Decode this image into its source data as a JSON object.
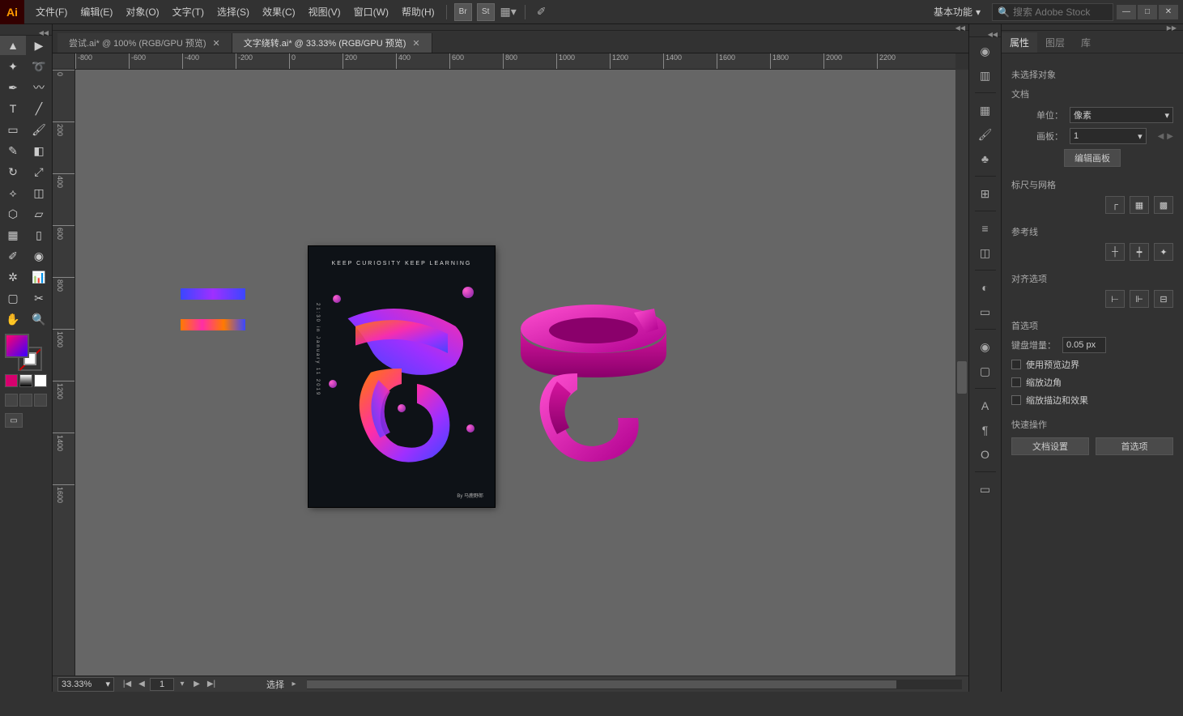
{
  "menu": [
    "文件(F)",
    "编辑(E)",
    "对象(O)",
    "文字(T)",
    "选择(S)",
    "效果(C)",
    "视图(V)",
    "窗口(W)",
    "帮助(H)"
  ],
  "menu_icons": [
    "Br",
    "St"
  ],
  "workspace": "基本功能",
  "search_placeholder": "搜索 Adobe Stock",
  "tabs": [
    {
      "label": "尝试.ai* @ 100% (RGB/GPU 预览)",
      "active": false
    },
    {
      "label": "文字绕转.ai* @ 33.33% (RGB/GPU 预览)",
      "active": true
    }
  ],
  "ruler_h": [
    -800,
    -600,
    -400,
    -200,
    0,
    200,
    400,
    600,
    800,
    1000,
    1200,
    1400,
    1600,
    1800,
    2000,
    2200
  ],
  "ruler_v": [
    0,
    200,
    400,
    600,
    800,
    1000,
    1200,
    1400,
    1600
  ],
  "artboard": {
    "title": "KEEP CURIOSITY KEEP LEARNING",
    "side": "21:30 in January 11 2019",
    "foot": "By 马鹿野郎"
  },
  "statusbar": {
    "zoom": "33.33%",
    "artboard": "1",
    "tool": "选择"
  },
  "panel": {
    "tabs": [
      "属性",
      "图层",
      "库"
    ],
    "no_selection": "未选择对象",
    "doc": "文档",
    "units_label": "单位：",
    "units_value": "像素",
    "artboard_label": "画板：",
    "artboard_value": "1",
    "edit_artboard": "编辑画板",
    "ruler_grid": "标尺与网格",
    "guides": "参考线",
    "align": "对齐选项",
    "prefs": "首选项",
    "key_inc_label": "键盘增量：",
    "key_inc_value": "0.05 px",
    "chk1": "使用预览边界",
    "chk2": "缩放边角",
    "chk3": "缩放描边和效果",
    "quick": "快速操作",
    "btn1": "文档设置",
    "btn2": "首选项"
  }
}
